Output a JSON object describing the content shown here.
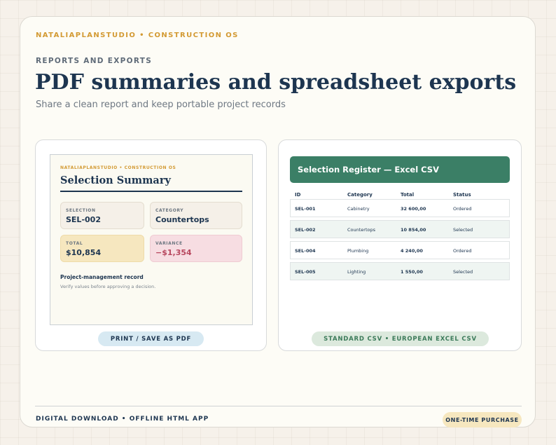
{
  "brand": "NATALIAPLANSTUDIO • CONSTRUCTION OS",
  "eyebrow": "REPORTS AND EXPORTS",
  "title": "PDF summaries and spreadsheet exports",
  "subtitle": "Share a clean report and keep portable project records",
  "pdf_preview": {
    "brand": "NATALIAPLANSTUDIO • CONSTRUCTION OS",
    "title": "Selection Summary",
    "metrics": [
      {
        "label": "SELECTION",
        "value": "SEL-002"
      },
      {
        "label": "CATEGORY",
        "value": "Countertops"
      },
      {
        "label": "TOTAL",
        "value": "$10,854"
      },
      {
        "label": "VARIANCE",
        "value": "−$1,354"
      }
    ],
    "note_title": "Project-management record",
    "note": "Verify values before approving a decision.",
    "button_label": "PRINT / SAVE AS PDF"
  },
  "csv_preview": {
    "title": "Selection Register — Excel CSV",
    "columns": [
      "ID",
      "Category",
      "Total",
      "Status"
    ],
    "rows": [
      [
        "SEL-001",
        "Cabinetry",
        "32 600,00",
        "Ordered"
      ],
      [
        "SEL-002",
        "Countertops",
        "10 854,00",
        "Selected"
      ],
      [
        "SEL-004",
        "Plumbing",
        "4 240,00",
        "Ordered"
      ],
      [
        "SEL-005",
        "Lighting",
        "1 550,00",
        "Selected"
      ]
    ],
    "format_label": "STANDARD CSV • EUROPEAN EXCEL CSV"
  },
  "footer": {
    "left": "DIGITAL DOWNLOAD • OFFLINE HTML APP",
    "badge": "ONE-TIME PURCHASE"
  },
  "colors": {
    "accent_gold": "#d39a33",
    "navy": "#1d3550",
    "green": "#3b7f66",
    "variance_red": "#b8485f"
  }
}
